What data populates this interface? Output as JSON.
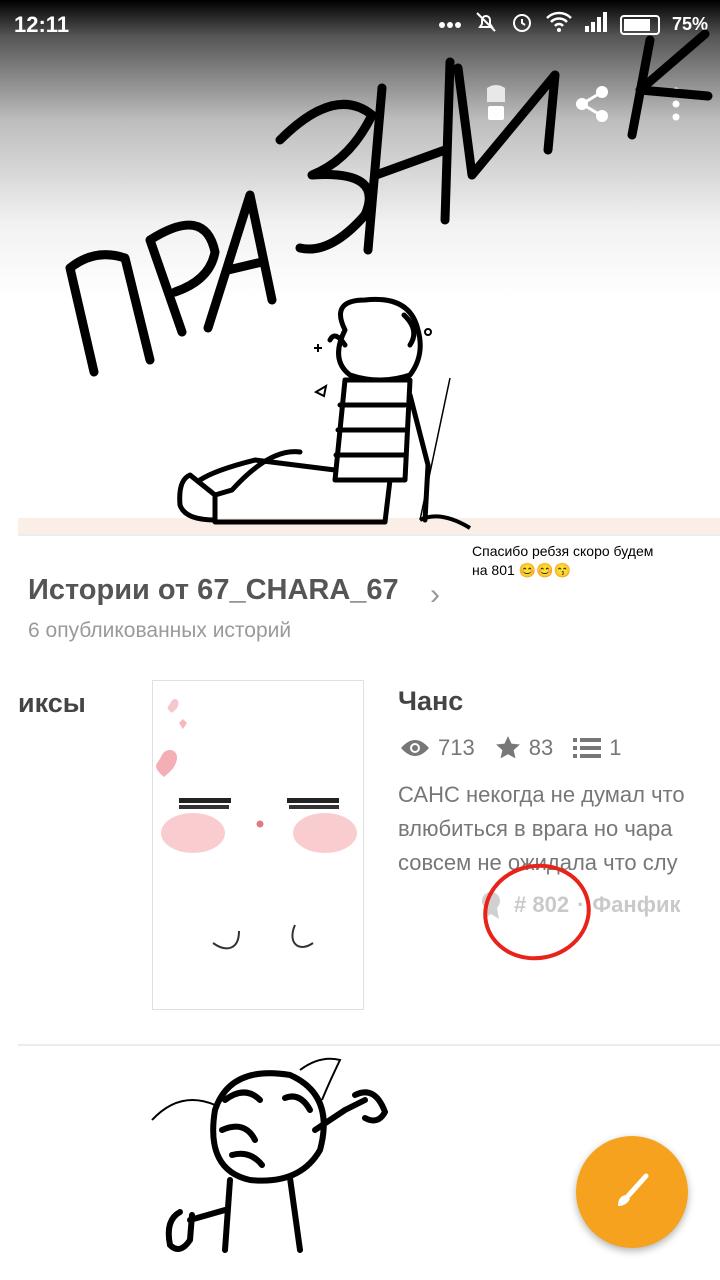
{
  "status_bar": {
    "time": "12:11",
    "battery": "75%"
  },
  "handwritten_title": "ПРАЗНИК",
  "caption": {
    "line1": "Спасибо ребзя скоро будем",
    "line2": "на 801 😊😊😙"
  },
  "stories": {
    "title": "Истории от 67_CHARA_67",
    "subtitle": "6 опубликованных историй"
  },
  "prev_story": {
    "title_fragment": "иксы"
  },
  "story": {
    "title": "Чанс",
    "views": "713",
    "stars": "83",
    "parts": "1",
    "description": [
      "САНС некогда не думал что",
      "влюбиться в врага но чара",
      "совсем не ожидала что слу"
    ],
    "rank": "# 802",
    "separator": "·",
    "category": "Фанфик"
  },
  "colors": {
    "accent": "#f7a21f",
    "marker_red": "#e8231a"
  }
}
